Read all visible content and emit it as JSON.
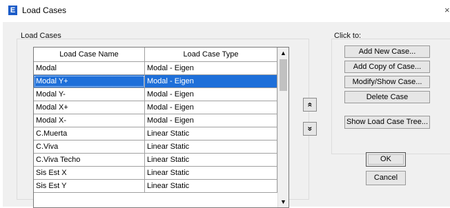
{
  "window": {
    "app_icon_letter": "E",
    "title": "Load Cases",
    "close_glyph": "×"
  },
  "group": {
    "label": "Load Cases"
  },
  "side": {
    "label": "Click to:"
  },
  "table": {
    "headers": [
      "Load Case Name",
      "Load Case Type"
    ],
    "rows": [
      {
        "name": "Modal",
        "type": "Modal - Eigen"
      },
      {
        "name": "Modal Y+",
        "type": "Modal - Eigen"
      },
      {
        "name": "Modal Y-",
        "type": "Modal - Eigen"
      },
      {
        "name": "Modal X+",
        "type": "Modal - Eigen"
      },
      {
        "name": "Modal X-",
        "type": "Modal - Eigen"
      },
      {
        "name": "C.Muerta",
        "type": "Linear Static"
      },
      {
        "name": "C.Viva",
        "type": "Linear Static"
      },
      {
        "name": "C.Viva Techo",
        "type": "Linear Static"
      },
      {
        "name": "Sis Est X",
        "type": "Linear Static"
      },
      {
        "name": "Sis Est Y",
        "type": "Linear Static"
      }
    ],
    "selected_row": "Modal Y+"
  },
  "scroll": {
    "up": "▲",
    "down": "▼"
  },
  "move": {
    "up": "⏶⏶",
    "down": "⏷⏷",
    "up_label": "«",
    "down_label": "»"
  },
  "buttons": {
    "add_new": "Add New Case...",
    "add_copy": "Add Copy of Case...",
    "modify_show": "Modify/Show Case...",
    "delete": "Delete Case",
    "show_tree": "Show Load Case Tree...",
    "ok": "OK",
    "cancel": "Cancel"
  },
  "colors": {
    "selection": "#1e6fd9",
    "app_icon": "#1c5cc8",
    "dialog_bg": "#f0f0f0"
  }
}
